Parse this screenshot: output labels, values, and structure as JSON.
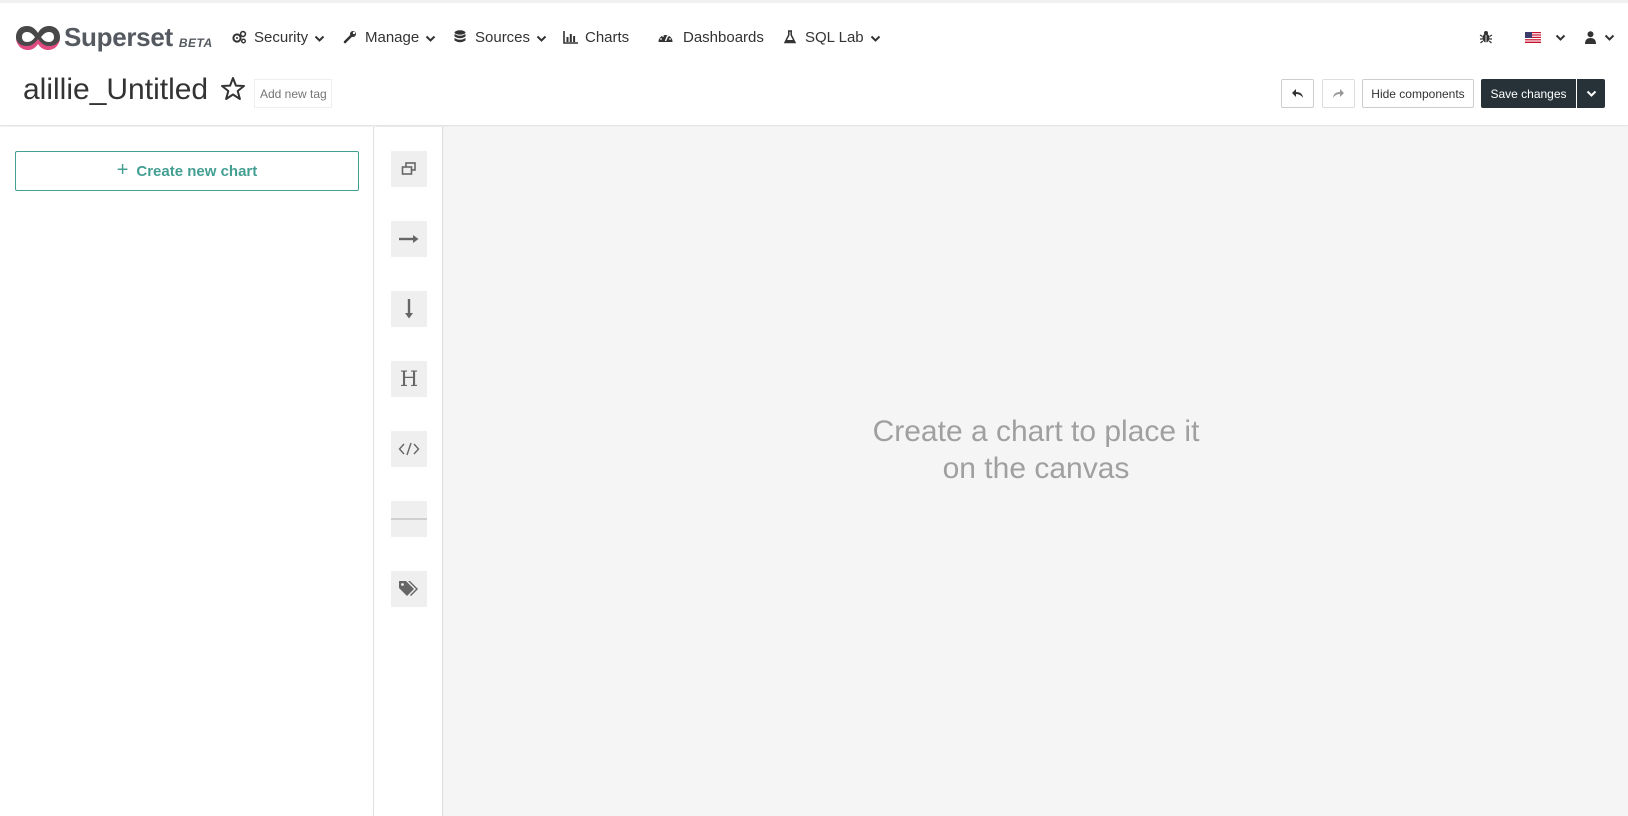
{
  "brand": {
    "name": "Superset",
    "badge": "BETA"
  },
  "nav": {
    "items": [
      {
        "label": "Security",
        "icon": "cogs-icon",
        "has_dropdown": true
      },
      {
        "label": "Manage",
        "icon": "wrench-icon",
        "has_dropdown": true
      },
      {
        "label": "Sources",
        "icon": "database-icon",
        "has_dropdown": true
      },
      {
        "label": "Charts",
        "icon": "bar-chart-icon",
        "has_dropdown": false
      },
      {
        "label": "Dashboards",
        "icon": "dashboard-icon",
        "has_dropdown": false
      },
      {
        "label": "SQL Lab",
        "icon": "flask-icon",
        "has_dropdown": true
      }
    ],
    "right": {
      "bug_icon": "bug-icon",
      "language_icon": "us-flag-icon",
      "user_icon": "user-icon"
    }
  },
  "header": {
    "title": "alillie_Untitled",
    "tag_placeholder": "Add new tag",
    "hide_components_label": "Hide components",
    "save_label": "Save changes"
  },
  "builder": {
    "create_chart_label": "Create new chart",
    "components": [
      "tabs-icon",
      "row-icon",
      "column-icon",
      "header-icon",
      "markdown-icon",
      "divider-icon",
      "tags-icon"
    ]
  },
  "canvas": {
    "empty_line1": "Create a chart to place it",
    "empty_line2": "on the canvas"
  },
  "colors": {
    "accent": "#449f93",
    "save_bg": "#263238",
    "brand_pink": "#e04b81",
    "brand_gray": "#484848"
  }
}
